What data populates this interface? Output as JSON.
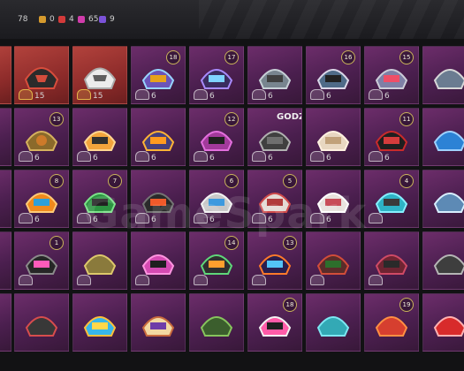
{
  "header": {
    "count_label": "78",
    "stats": [
      {
        "icon": "orange-square-icon",
        "color": "#d59a2d",
        "value": "0"
      },
      {
        "icon": "red-square-icon",
        "color": "#d33a3a",
        "value": "4"
      },
      {
        "icon": "pink-square-icon",
        "color": "#d03cab",
        "value": "65"
      },
      {
        "icon": "purple-square-icon",
        "color": "#7b52d8",
        "value": "9"
      }
    ]
  },
  "inventory": {
    "badge_labels": [
      "18",
      "17",
      "15",
      "16",
      "15",
      "13",
      "12",
      "11",
      "8",
      "7",
      "6",
      "5",
      "4",
      "1",
      "14",
      "13",
      "18",
      "19"
    ],
    "counts": [
      "15",
      "15",
      "6",
      "6",
      "6",
      "6",
      "6",
      "6",
      "6",
      "6",
      "6",
      "6",
      "6",
      "6",
      "6",
      "6",
      "6",
      "6",
      "6",
      "6"
    ],
    "special_label": "GODZILLA"
  },
  "watermark": "GameSpark"
}
